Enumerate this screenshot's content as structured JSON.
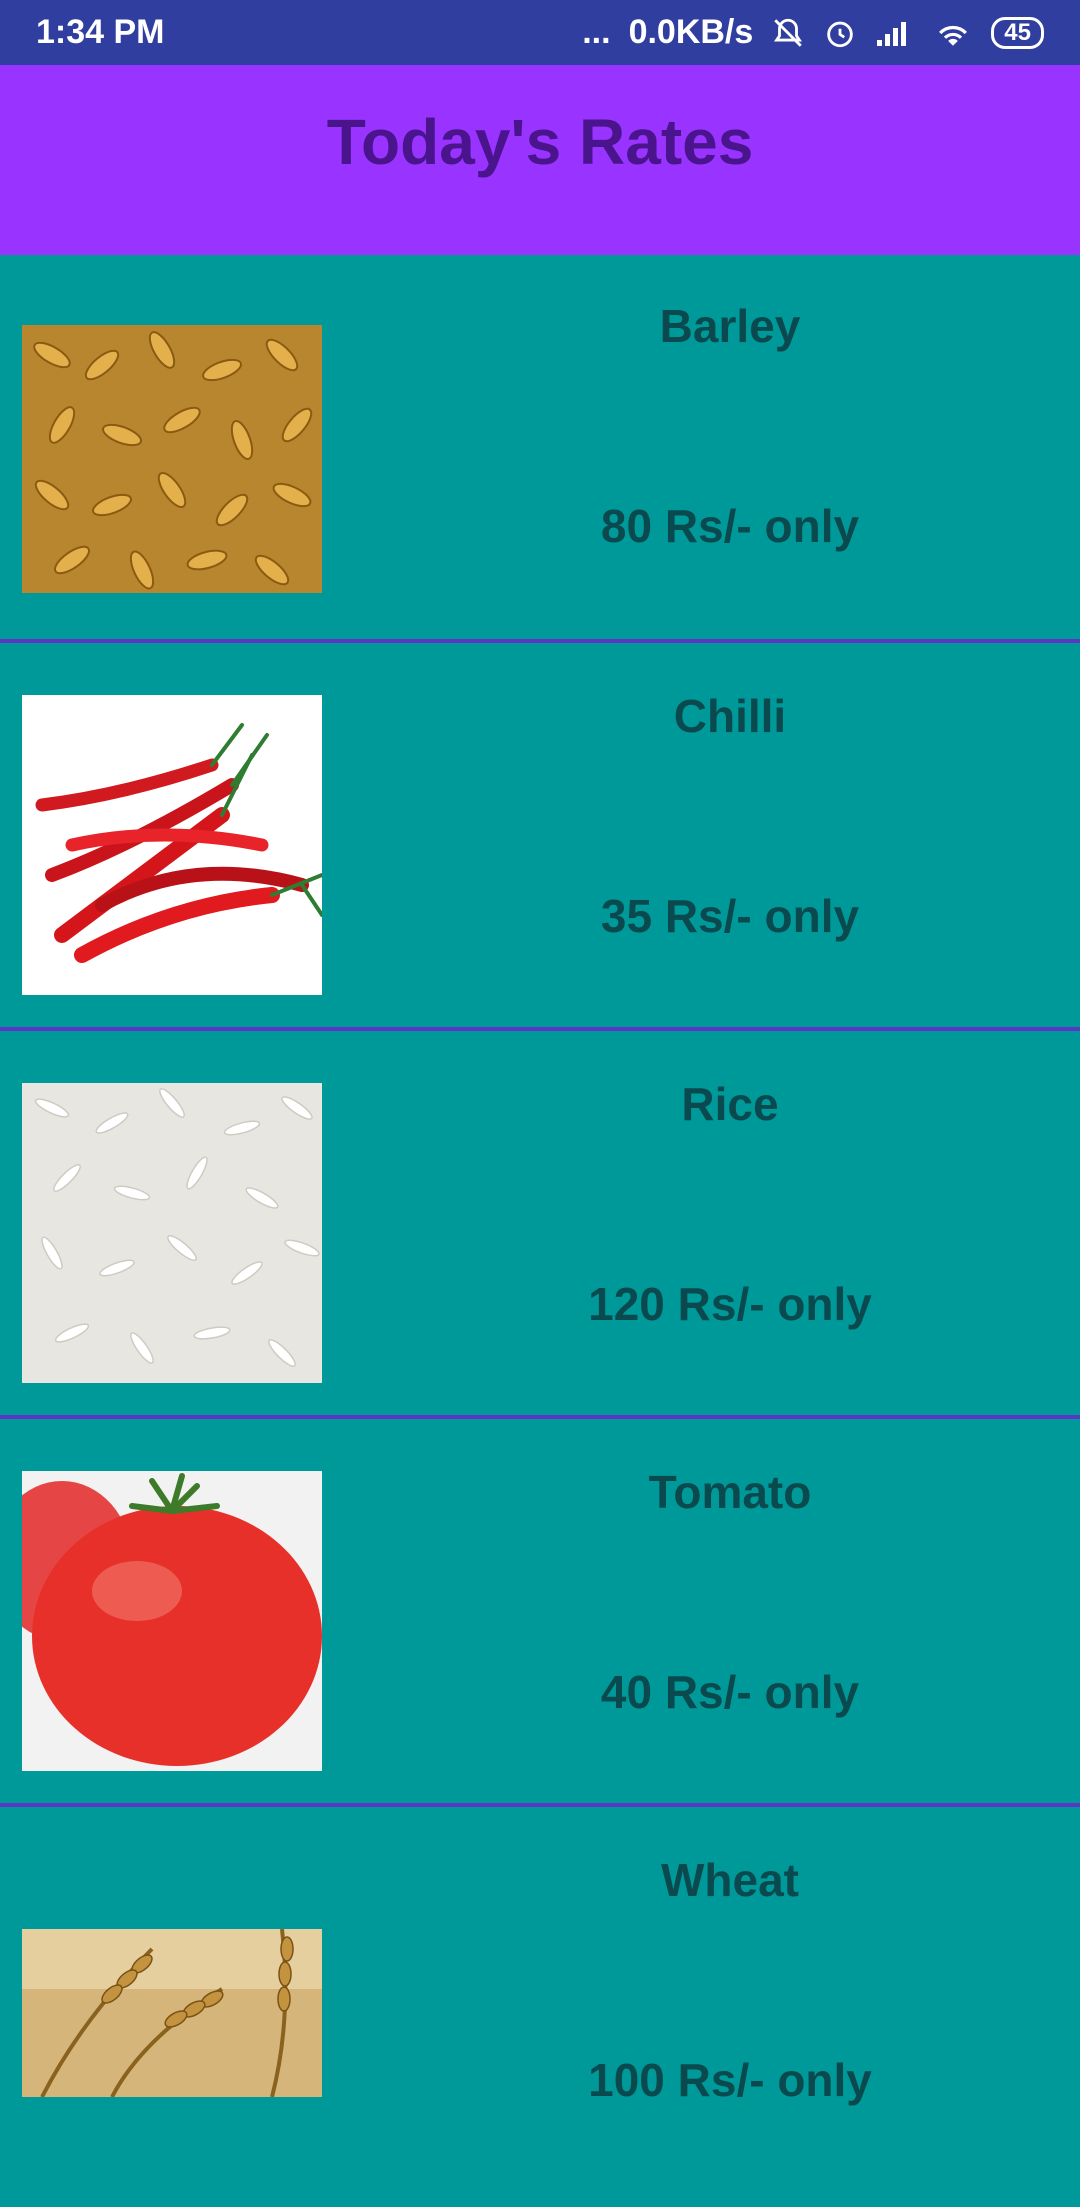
{
  "status_bar": {
    "time": "1:34 PM",
    "dots": "...",
    "net_speed": "0.0KB/s",
    "battery": "45",
    "icons": [
      "mute-icon",
      "alarm-icon",
      "signal-icon",
      "wifi-icon",
      "battery-icon"
    ]
  },
  "header": {
    "title": "Today's Rates"
  },
  "items": [
    {
      "name": "Barley",
      "price": "80 Rs/- only",
      "image": "barley-image"
    },
    {
      "name": "Chilli",
      "price": "35 Rs/- only",
      "image": "chilli-image"
    },
    {
      "name": "Rice",
      "price": "120 Rs/- only",
      "image": "rice-image"
    },
    {
      "name": "Tomato",
      "price": "40 Rs/- only",
      "image": "tomato-image"
    },
    {
      "name": "Wheat",
      "price": "100 Rs/- only",
      "image": "wheat-image"
    }
  ],
  "colors": {
    "status_bar": "#303f9f",
    "app_bar": "#9933ff",
    "title_text": "#4a148c",
    "list_background": "#009999",
    "item_text": "#0a4a4f",
    "divider": "#5c35c6"
  }
}
